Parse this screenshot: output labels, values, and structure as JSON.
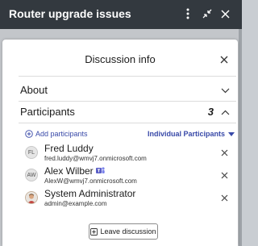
{
  "window": {
    "title": "Router upgrade issues"
  },
  "dialog": {
    "title": "Discussion info",
    "about_label": "About",
    "participants_label": "Participants",
    "participants_count": "3",
    "add_participants": "Add participants",
    "filter_label": "Individual Participants",
    "participants": [
      {
        "initials": "FL",
        "name": "Fred Luddy",
        "email": "fred.luddy@wmvj7.onmicrosoft.com"
      },
      {
        "initials": "AW",
        "name": "Alex Wilber",
        "email": "AlexW@wmvj7.onmicrosoft.com"
      },
      {
        "initials": "",
        "name": "System Administrator",
        "email": "admin@example.com"
      }
    ],
    "leave_label": "Leave discussion"
  },
  "icons": {
    "more": "more-vertical-icon",
    "collapse": "collapse-icon",
    "close": "close-icon",
    "chevron_down": "chevron-down-icon",
    "chevron_up": "chevron-up-icon",
    "add": "add-circle-icon",
    "caret": "caret-down-icon",
    "remove": "remove-icon",
    "teams": "teams-icon",
    "leave": "leave-icon"
  },
  "colors": {
    "topbar": "#33393f",
    "link": "#3849a8",
    "teams": "#5b5fc7"
  }
}
